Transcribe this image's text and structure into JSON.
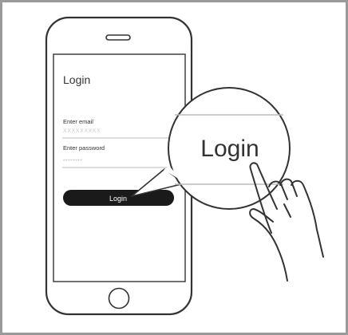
{
  "screen": {
    "title": "Login",
    "email_label": "Enter email",
    "email_value": "XXXXXXXXX",
    "password_label": "Enter password",
    "password_value": "••••••••",
    "login_button_label": "Login"
  },
  "magnifier": {
    "label": "Login"
  },
  "colors": {
    "outline": "#333333",
    "frame": "#9a9a9a",
    "divider": "#bbbbbb",
    "placeholder": "#cccccc",
    "button": "#1a1a1a",
    "button_text": "#ffffff"
  }
}
